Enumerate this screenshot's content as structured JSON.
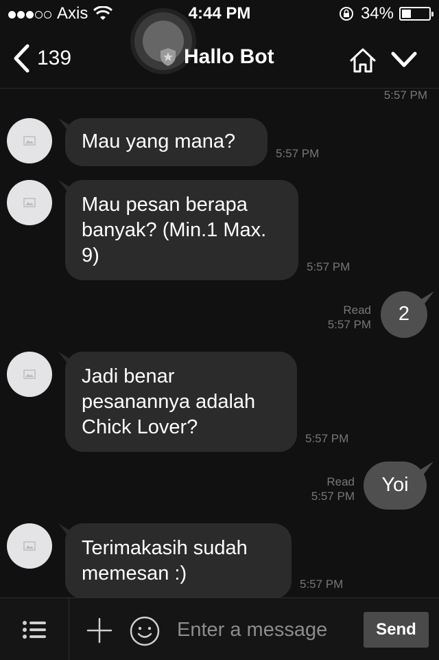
{
  "status_bar": {
    "carrier": "Axis",
    "time": "4:44 PM",
    "battery": "34%",
    "battery_level": 0.34,
    "signal_bars_filled": 3,
    "signal_bars_total": 5
  },
  "header": {
    "back_count": "139",
    "title": "Hallo Bot",
    "icons": [
      "chevron-left-icon",
      "shield-star-icon",
      "home-icon",
      "chevron-down-icon"
    ]
  },
  "messages": [
    {
      "direction": "incoming",
      "text": "",
      "time": "5:57 PM"
    },
    {
      "direction": "incoming",
      "text": "Mau yang mana?",
      "time": "5:57 PM"
    },
    {
      "direction": "incoming",
      "lines": [
        "Mau pesan berapa",
        "banyak? (Min.1 Max.",
        "9)"
      ],
      "time": "5:57 PM"
    },
    {
      "direction": "outgoing",
      "text": "2",
      "status": "Read",
      "time": "5:57 PM"
    },
    {
      "direction": "incoming",
      "lines": [
        "Jadi benar",
        "pesanannya adalah",
        "Chick Lover?"
      ],
      "time": "5:57 PM"
    },
    {
      "direction": "outgoing",
      "text": "Yoi",
      "status": "Read",
      "time": "5:57 PM"
    },
    {
      "direction": "incoming",
      "lines": [
        "Terimakasih sudah",
        "memesan :)"
      ],
      "time": "5:57 PM"
    }
  ],
  "composer": {
    "placeholder": "Enter a message",
    "send_label": "Send",
    "icons": [
      "menu-list-icon",
      "plus-icon",
      "emoji-icon"
    ]
  },
  "colors": {
    "background": "#111111",
    "incoming_bubble": "#2b2b2b",
    "outgoing_bubble": "#4f4f4f",
    "timestamp": "#777777"
  }
}
